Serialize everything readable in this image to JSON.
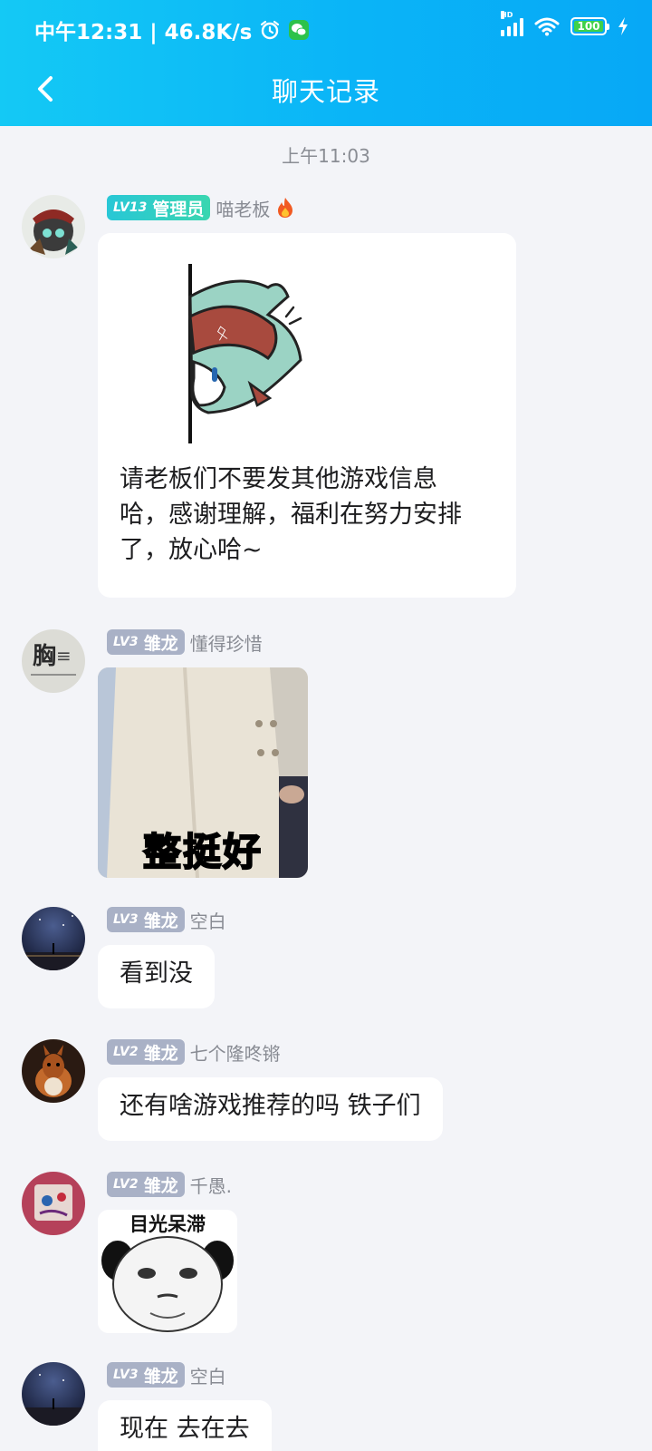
{
  "status_bar": {
    "time_speed": "中午12:31 | 46.8K/s",
    "alarm_icon": "alarm-clock-icon",
    "wechat_icon": "wechat-icon",
    "network": "HD",
    "battery": "100"
  },
  "header": {
    "title": "聊天记录",
    "back_icon": "chevron-left-icon"
  },
  "time_separator": "上午11:03",
  "messages": [
    {
      "badge_level": "LV13",
      "badge_role": "管理员",
      "badge_style": "admin",
      "nickname": "喵老板",
      "has_fire_icon": true,
      "text": "请老板们不要发其他游戏信息\n哈，感谢理解，福利在努力安排\n了，放心哈~",
      "sticker": "peeking-cat-pirate-sticker"
    },
    {
      "badge_level": "LV3",
      "badge_role": "雏龙",
      "nickname": "懂得珍惜",
      "image_caption": "整挺好"
    },
    {
      "badge_level": "LV3",
      "badge_role": "雏龙",
      "nickname": "空白",
      "text": "看到没"
    },
    {
      "badge_level": "LV2",
      "badge_role": "雏龙",
      "nickname": "七个隆咚锵",
      "text": "还有啥游戏推荐的吗 铁子们"
    },
    {
      "badge_level": "LV2",
      "badge_role": "雏龙",
      "nickname": "千愚.",
      "image_caption": "目光呆滞"
    },
    {
      "badge_level": "LV3",
      "badge_role": "雏龙",
      "nickname": "空白",
      "text": "现在 去在去"
    }
  ],
  "colors": {
    "header_start": "#14c9f5",
    "header_end": "#07a8f6",
    "background": "#f3f4f8",
    "admin_badge": "#2ccfc6",
    "member_badge": "#a9b1c6"
  }
}
